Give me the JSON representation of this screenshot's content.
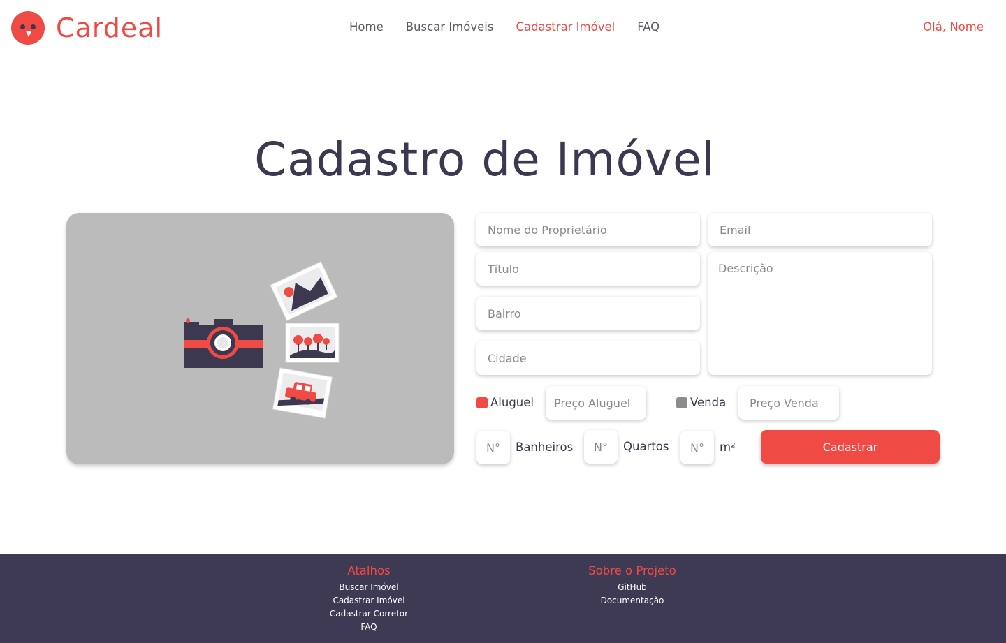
{
  "brand": {
    "name": "Cardeal",
    "color": "#f04a45"
  },
  "nav": {
    "items": [
      {
        "label": "Home"
      },
      {
        "label": "Buscar Imóveis"
      },
      {
        "label": "Cadastrar Imóvel"
      },
      {
        "label": "FAQ"
      }
    ],
    "active_index": 2,
    "greeting": "Olá, Nome"
  },
  "page": {
    "title": "Cadastro de Imóvel"
  },
  "form": {
    "owner_placeholder": "Nome do Proprietário",
    "email_placeholder": "Email",
    "title_placeholder": "Título",
    "description_placeholder": "Descrição",
    "neighborhood_placeholder": "Bairro",
    "city_placeholder": "Cidade",
    "rent_label": "Aluguel",
    "rent_price_placeholder": "Preço Aluguel",
    "sale_label": "Venda",
    "sale_price_placeholder": "Preço Venda",
    "number_placeholder": "N°",
    "bathrooms_label": "Banheiros",
    "bedrooms_label": "Quartos",
    "area_label": "m²",
    "submit_label": "Cadastrar"
  },
  "footer": {
    "shortcuts_title": "Atalhos",
    "shortcuts": [
      "Buscar Imóvel",
      "Cadastrar Imóvel",
      "Cadastrar Corretor",
      "FAQ"
    ],
    "project_title": "Sobre o Projeto",
    "project_links": [
      "GitHub",
      "Documentação"
    ]
  },
  "colors": {
    "accent": "#f04a45",
    "dark": "#3b3850",
    "footer_bg": "#3e3a54",
    "card_bg": "#bbbbbb"
  }
}
